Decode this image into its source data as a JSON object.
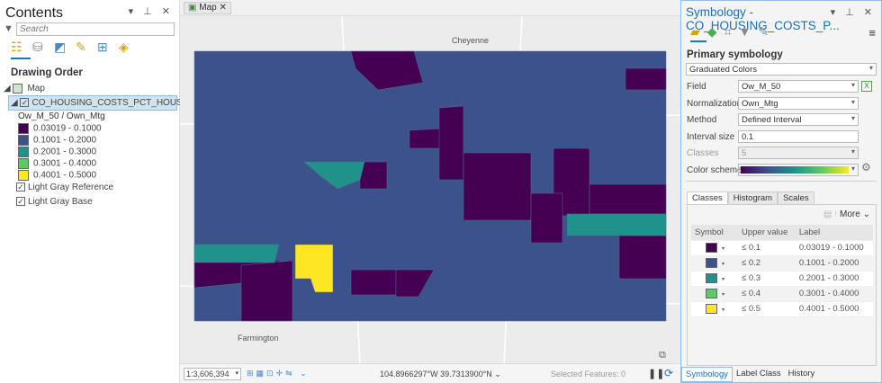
{
  "contents": {
    "title": "Contents",
    "search_placeholder": "Search",
    "drawing_order": "Drawing Order",
    "map_label": "Map",
    "layer": "CO_HOUSING_COSTS_PCT_HOUSEHOLD_INCO...",
    "legend_title": "Ow_M_50 / Own_Mtg",
    "legend": [
      {
        "label": "0.03019 - 0.1000",
        "color": "#440154"
      },
      {
        "label": "0.1001 - 0.2000",
        "color": "#3b528b"
      },
      {
        "label": "0.2001 - 0.3000",
        "color": "#21918c"
      },
      {
        "label": "0.3001 - 0.4000",
        "color": "#5ec962"
      },
      {
        "label": "0.4001 - 0.5000",
        "color": "#fde725"
      }
    ],
    "basemaps": [
      "Light Gray Reference",
      "Light Gray Base"
    ]
  },
  "map": {
    "tab": "Map",
    "places": [
      "Cheyenne",
      "Farmington"
    ],
    "scale": "1:3,606,394",
    "coords": "104.8966297°W 39.7313900°N",
    "selected": "Selected Features: 0"
  },
  "symbology": {
    "title": "Symbology - CO_HOUSING_COSTS_P...",
    "primary": "Primary symbology",
    "type": "Graduated Colors",
    "fields": [
      {
        "label": "Field",
        "value": "Ow_M_50"
      },
      {
        "label": "Normalization",
        "value": "Own_Mtg"
      },
      {
        "label": "Method",
        "value": "Defined Interval"
      },
      {
        "label": "Interval size",
        "value": "0.1"
      },
      {
        "label": "Classes",
        "value": "5"
      },
      {
        "label": "Color scheme",
        "value": ""
      }
    ],
    "tabs": [
      "Classes",
      "Histogram",
      "Scales"
    ],
    "more": "More",
    "columns": [
      "Symbol",
      "Upper value",
      "Label"
    ],
    "rows": [
      {
        "upper": "≤  0.1",
        "label": "0.03019 - 0.1000",
        "color": "#440154"
      },
      {
        "upper": "≤  0.2",
        "label": "0.1001 - 0.2000",
        "color": "#3b528b"
      },
      {
        "upper": "≤  0.3",
        "label": "0.2001 - 0.3000",
        "color": "#21918c"
      },
      {
        "upper": "≤  0.4",
        "label": "0.3001 - 0.4000",
        "color": "#5ec962"
      },
      {
        "upper": "≤  0.5",
        "label": "0.4001 - 0.5000",
        "color": "#fde725"
      }
    ],
    "bottom_tabs": [
      "Symbology",
      "Label Class",
      "History"
    ]
  }
}
